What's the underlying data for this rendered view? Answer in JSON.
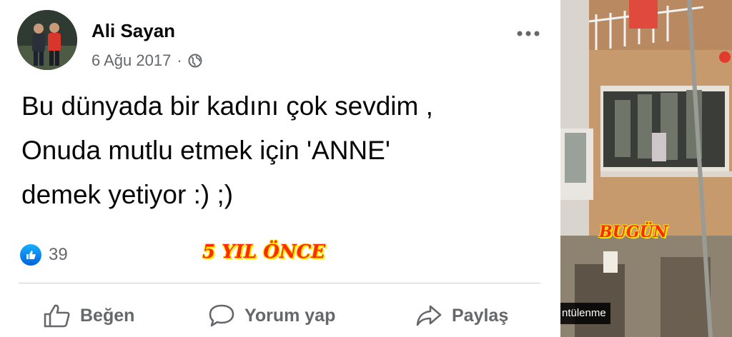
{
  "post": {
    "author_name": "Ali Sayan",
    "date": "6 Ağu 2017",
    "separator": "·",
    "icons": {
      "privacy": "globe-icon",
      "more": "more-options-icon",
      "like_badge": "thumbs-up-icon"
    },
    "text_lines": [
      "Bu dünyada bir kadını çok sevdim ,",
      "Onuda mutlu etmek için 'ANNE'",
      "demek yetiyor :) ;)"
    ],
    "like_count": "39",
    "actions": {
      "like_label": "Beğen",
      "comment_label": "Yorum yap",
      "share_label": "Paylaş"
    }
  },
  "overlays": {
    "past_label": "5 YIL ÖNCE",
    "now_label": "BUGÜN",
    "video_caption": "ntülenme"
  },
  "colors": {
    "text": "#050505",
    "secondary_text": "#65676b",
    "like_blue": "#1877f2",
    "overlay_red": "#ff2a00",
    "overlay_outline": "#ffe800"
  }
}
